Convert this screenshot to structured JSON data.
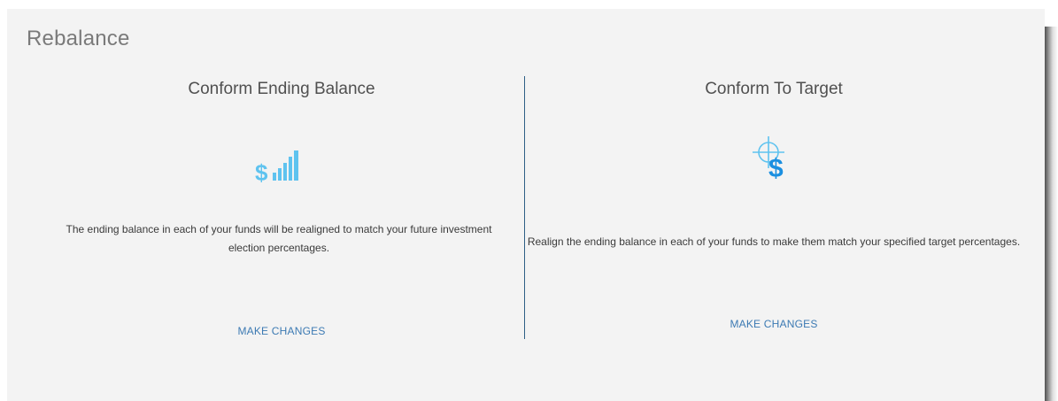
{
  "page": {
    "title": "Rebalance"
  },
  "options": [
    {
      "heading": "Conform Ending Balance",
      "icon": "dollar-signal-bars-icon",
      "description": "The ending balance in each of your funds will be realigned to match your future investment election percentages.",
      "action_label": "MAKE CHANGES"
    },
    {
      "heading": "Conform To Target",
      "icon": "dollar-target-crosshair-icon",
      "description": "Realign the ending balance in each of your funds to make them match your specified target percentages.",
      "action_label": "MAKE CHANGES"
    }
  ],
  "colors": {
    "accent": "#3c7ab3",
    "icon_light": "#5fc3ef",
    "icon_blue": "#1a8fe0",
    "divider": "#2e5f86"
  }
}
